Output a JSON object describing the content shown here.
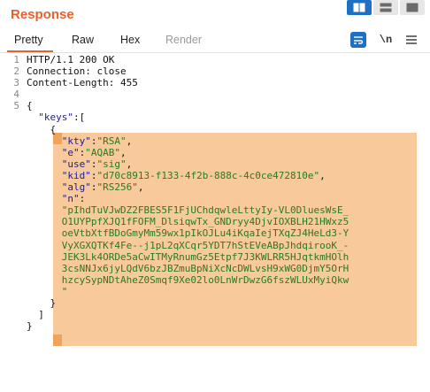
{
  "header": {
    "title": "Response"
  },
  "layout_buttons": [
    {
      "name": "split-horizontal",
      "active": true
    },
    {
      "name": "split-vertical",
      "active": false
    },
    {
      "name": "single-pane",
      "active": false
    }
  ],
  "tabs": [
    {
      "label": "Pretty",
      "active": true
    },
    {
      "label": "Raw",
      "active": false
    },
    {
      "label": "Hex",
      "active": false
    },
    {
      "label": "Render",
      "active": false
    }
  ],
  "tools": {
    "newline_label": "\\n"
  },
  "code_lines": [
    {
      "n": "1",
      "text": "HTTP/1.1 200 OK"
    },
    {
      "n": "2",
      "text": "Connection: close"
    },
    {
      "n": "3",
      "text": "Content-Length: 455"
    },
    {
      "n": "4",
      "text": ""
    },
    {
      "n": "5",
      "text": "{"
    },
    {
      "n": "",
      "text": "  \"keys\":["
    },
    {
      "n": "",
      "text": "    {"
    },
    {
      "n": "",
      "text": "      \"kty\":\"RSA\","
    },
    {
      "n": "",
      "text": "      \"e\":\"AQAB\","
    },
    {
      "n": "",
      "text": "      \"use\":\"sig\","
    },
    {
      "n": "",
      "text": "      \"kid\":\"d70c8913-f133-4f2b-888c-4c0ce472810e\","
    },
    {
      "n": "",
      "text": "      \"alg\":\"RS256\","
    },
    {
      "n": "",
      "text": "      \"n\":"
    },
    {
      "n": "",
      "text": "      \"pIhdTuVJwDZ2FBES5F1FjUChdqwleLttyIy-VL0DluesWsE_"
    },
    {
      "n": "",
      "text": "      O1UYPpfXJQ1fFOFM_DlsiqwTx_GNDryy4DjvIOXBLH21HWxz5"
    },
    {
      "n": "",
      "text": "      oeVtbXtfBDoGmyMm59wx1pIkOJLu4iKqaIejTXqZJ4HeLd3-Y"
    },
    {
      "n": "",
      "text": "      VyXGXQTKf4Fe--j1pL2qXCqr5YDT7hStEVeABpJhdqirooK_-"
    },
    {
      "n": "",
      "text": "      JEK3Lk4ORDe5aCwITMyRnumGz5Etpf7J3KWLRR5HJqtkmHOlh"
    },
    {
      "n": "",
      "text": "      3csNNJx6jyLQdV6bzJBZmuBpNiXcNcDWLvsH9xWG0DjmY5OrH"
    },
    {
      "n": "",
      "text": "      hzcySypNDtAheZ0Smqf9Xe02lo0LnWrDwzG6fszWLUxMyiQkw"
    },
    {
      "n": "",
      "text": "      \""
    },
    {
      "n": "",
      "text": "    }"
    },
    {
      "n": "",
      "text": "  ]"
    },
    {
      "n": "",
      "text": "}"
    }
  ],
  "colors": {
    "accent": "#e8612c",
    "active_button": "#1f6fc2",
    "highlight": "#f8c99a",
    "highlight_bracket": "#f0a35c",
    "json_key": "#1d1d8a",
    "json_string": "#2b7a1e"
  }
}
